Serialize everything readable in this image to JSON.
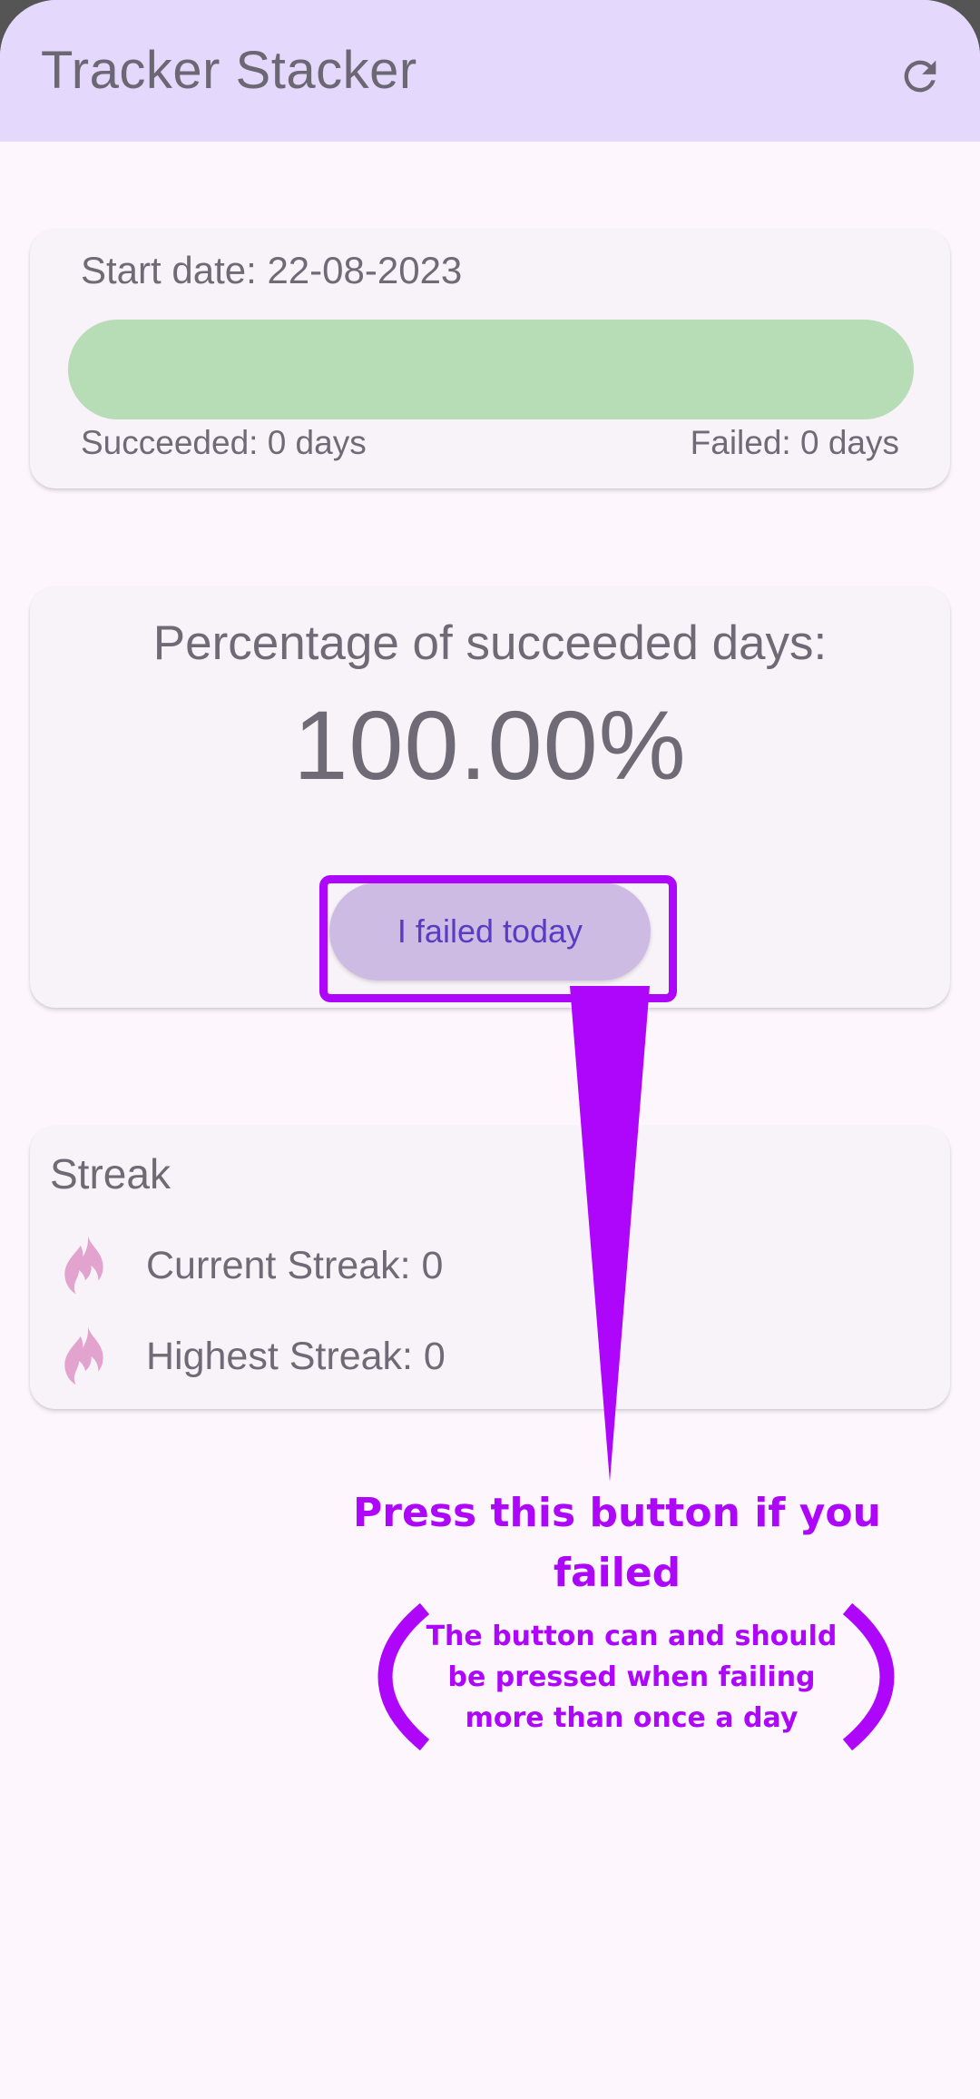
{
  "app": {
    "title": "Tracker Stacker",
    "refresh_icon": "refresh-icon"
  },
  "progress_card": {
    "start_date": "Start date: 22-08-2023",
    "succeeded_label": "Succeeded: 0 days",
    "failed_label": "Failed: 0 days",
    "success_fraction": 1.0,
    "success_color": "#b7ddb7"
  },
  "percentage_card": {
    "heading": "Percentage of succeeded days:",
    "value": "100.00%",
    "fail_button_label": "I failed today"
  },
  "streak_card": {
    "title": "Streak",
    "current_streak": "Current Streak: 0",
    "highest_streak": "Highest Streak: 0",
    "icon": "fire-icon"
  },
  "annotation": {
    "main_text": "Press this button if you failed",
    "note_text": "The button can and should be pressed when failing more than once a day",
    "color": "#ad06fb"
  }
}
